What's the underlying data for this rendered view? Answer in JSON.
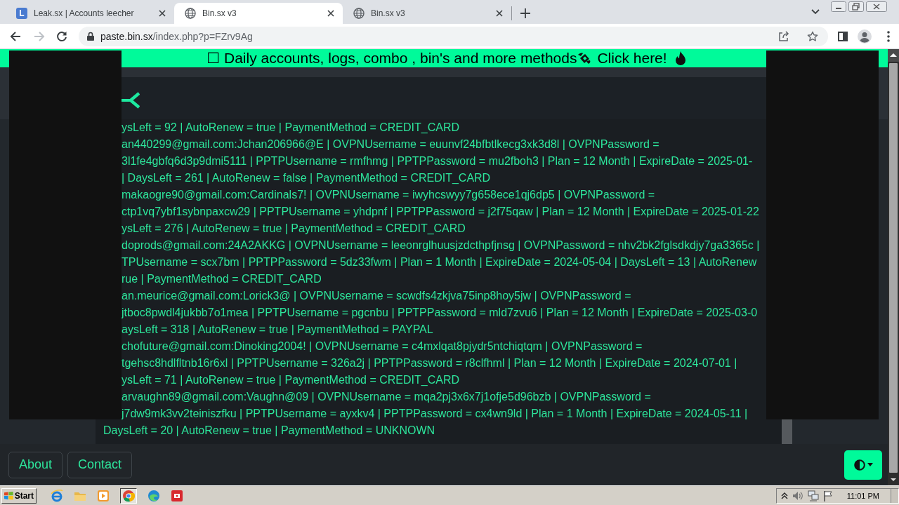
{
  "browser": {
    "tabs": [
      {
        "favicon_letter": "L",
        "title": "Leak.sx | Accounts leecher",
        "selected": false
      },
      {
        "title": "Bin.sx v3",
        "selected": true
      },
      {
        "title": "Bin.sx v3",
        "selected": false
      }
    ]
  },
  "toolbar": {
    "forward_disabled": true,
    "url_host": "paste.bin.sx",
    "url_path": "/index.php?p=FZrv9Ag"
  },
  "banner": {
    "text": "☐ Daily accounts, logs, combo , bin's and more methods",
    "link": "Click here!"
  },
  "paste": {
    "lines": [
      {
        "kind": "clipped",
        "text": "ysLeft = 92 | AutoRenew = true | PaymentMethod = CREDIT_CARD"
      },
      {
        "kind": "clipped",
        "text": "an440299@gmail.com:Jchan206966@E | OVPNUsername = euunvf24bfbtlkecg3xk3d8l | OVPNPassword ="
      },
      {
        "kind": "clipped",
        "text": "3l1fe4gbfq6d3p9dmi5111 | PPTPUsername = rmfhmg | PPTPPassword = mu2fboh3 | Plan = 12 Month | ExpireDate = 2025-01-"
      },
      {
        "kind": "clipped",
        "text": "| DaysLeft = 261 | AutoRenew = false | PaymentMethod = CREDIT_CARD"
      },
      {
        "kind": "clipped",
        "text": "makaogre90@gmail.com:Cardinals7! | OVPNUsername = iwyhcswyy7g658ece1qj6dp5 | OVPNPassword ="
      },
      {
        "kind": "clipped",
        "text": "ctp1vq7ybf1sybnpaxcw29 | PPTPUsername = yhdpnf | PPTPPassword = j2f75qaw | Plan = 12 Month | ExpireDate = 2025-01-22"
      },
      {
        "kind": "clipped",
        "text": "ysLeft = 276 | AutoRenew = true | PaymentMethod = CREDIT_CARD"
      },
      {
        "kind": "clipped",
        "text": "doprods@gmail.com:24A2AKKG | OVPNUsername = leeonrglhuusjzdcthpfjnsg | OVPNPassword = nhv2bk2fglsdkdjy7ga3365c |"
      },
      {
        "kind": "clipped",
        "text": "TPUsername = scx7bm | PPTPPassword = 5dz33fwm | Plan = 1 Month | ExpireDate = 2024-05-04 | DaysLeft = 13 | AutoRenew"
      },
      {
        "kind": "clipped",
        "text": "rue | PaymentMethod = CREDIT_CARD"
      },
      {
        "kind": "clipped",
        "text": "an.meurice@gmail.com:Lorick3@ | OVPNUsername = scwdfs4zkjva75inp8hoy5jw | OVPNPassword ="
      },
      {
        "kind": "clipped",
        "text": "jtboc8pwdl4jukbb7o1mea | PPTPUsername = pgcnbu | PPTPPassword = mld7zvu6 | Plan = 12 Month | ExpireDate = 2025-03-0"
      },
      {
        "kind": "clipped",
        "text": "aysLeft = 318 | AutoRenew = true | PaymentMethod = PAYPAL"
      },
      {
        "kind": "clipped",
        "text": "chofuture@gmail.com:Dinoking2004! | OVPNUsername = c4mxlqat8pjydr5ntchiqtqm | OVPNPassword ="
      },
      {
        "kind": "clipped",
        "text": "tgehsc8hdlfltnb16r6xl | PPTPUsername = 326a2j | PPTPPassword = r8clfhml | Plan = 12 Month | ExpireDate = 2024-07-01 |"
      },
      {
        "kind": "clipped",
        "text": "ysLeft = 71 | AutoRenew = true | PaymentMethod = CREDIT_CARD"
      },
      {
        "kind": "clipped",
        "text": "arvaughn89@gmail.com:Vaughn@09 | OVPNUsername = mqa2pj3x6x7j1ofje5d96bzb | OVPNPassword ="
      },
      {
        "kind": "clipped",
        "text": "j7dw9mk3vv2teiniszfku | PPTPUsername = ayxkv4 | PPTPPassword = cx4wn9ld | Plan = 1 Month | ExpireDate = 2024-05-11 |"
      },
      {
        "kind": "whole",
        "text": "DaysLeft = 20 | AutoRenew = true | PaymentMethod = UNKNOWN"
      }
    ]
  },
  "footer": {
    "links": [
      "About",
      "Contact"
    ]
  },
  "taskbar": {
    "start": "Start",
    "clock": "11:01 PM"
  }
}
